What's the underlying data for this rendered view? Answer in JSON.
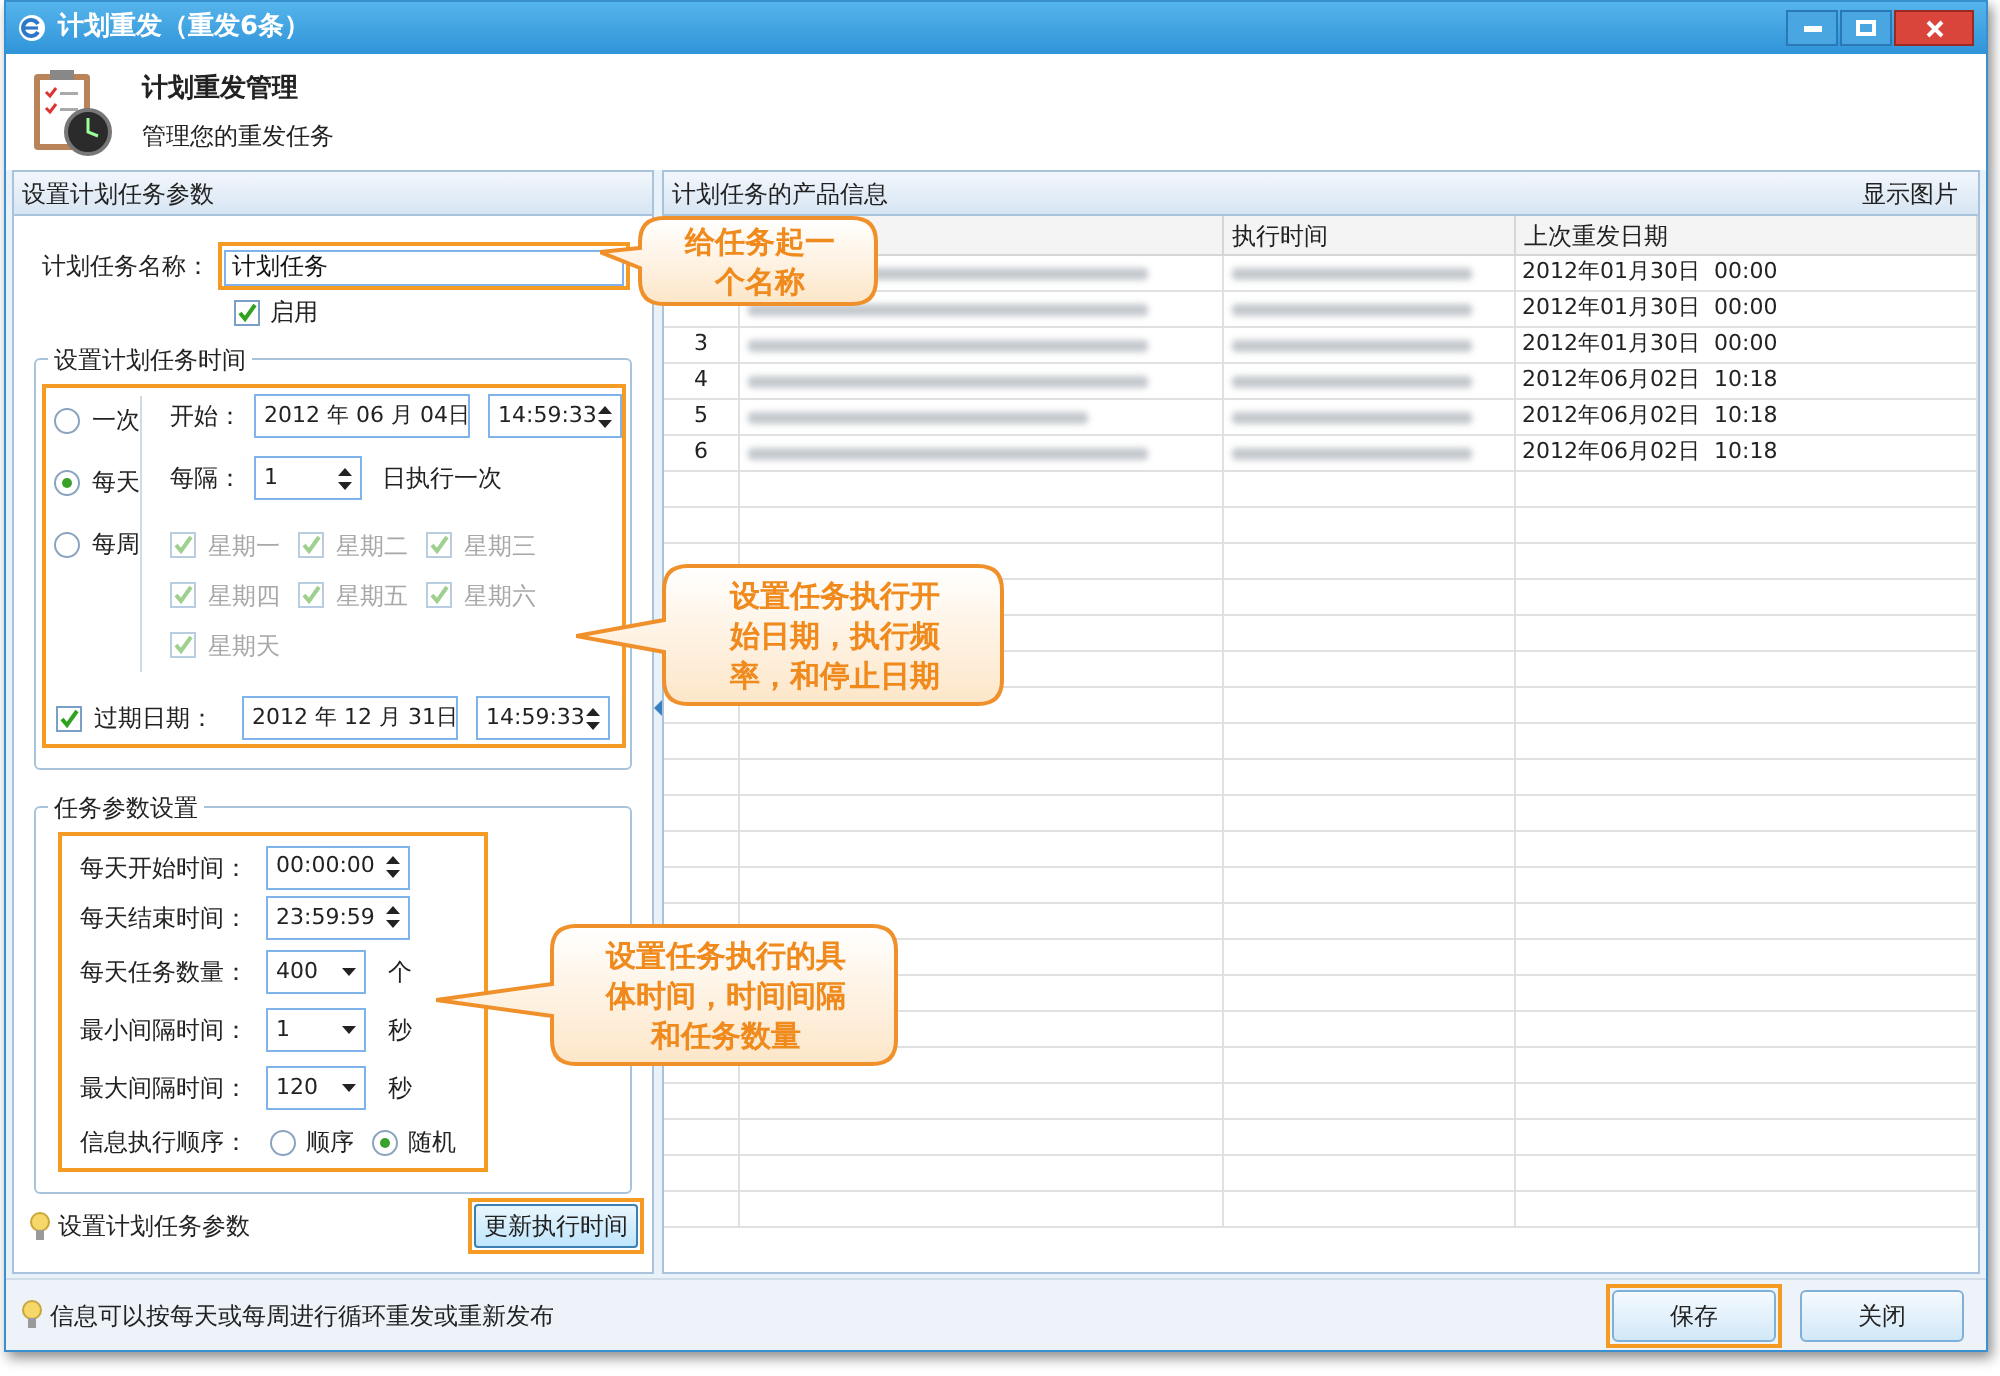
{
  "window": {
    "title": "计划重发（重发6条）"
  },
  "header": {
    "title": "计划重发管理",
    "subtitle": "管理您的重发任务"
  },
  "left_panel": {
    "title": "设置计划任务参数",
    "name_label": "计划任务名称：",
    "name_value": "计划任务",
    "enabled": {
      "label": "启用",
      "checked": true
    },
    "time_group": {
      "title": "设置计划任务时间",
      "modes": [
        {
          "label": "一次",
          "selected": false
        },
        {
          "label": "每天",
          "selected": true
        },
        {
          "label": "每周",
          "selected": false
        }
      ],
      "start_label": "开始：",
      "start_date": "2012 年 06 月 04日",
      "start_time": "14:59:33",
      "interval_label": "每隔：",
      "interval_value": "1",
      "interval_suffix": "日执行一次",
      "weekdays": [
        {
          "label": "星期一",
          "checked": true,
          "disabled": true
        },
        {
          "label": "星期二",
          "checked": true,
          "disabled": true
        },
        {
          "label": "星期三",
          "checked": true,
          "disabled": true
        },
        {
          "label": "星期四",
          "checked": true,
          "disabled": true
        },
        {
          "label": "星期五",
          "checked": true,
          "disabled": true
        },
        {
          "label": "星期六",
          "checked": true,
          "disabled": true
        },
        {
          "label": "星期天",
          "checked": true,
          "disabled": true
        }
      ],
      "expire": {
        "label": "过期日期：",
        "checked": true,
        "date": "2012 年 12 月 31日",
        "time": "14:59:33"
      }
    },
    "param_group": {
      "title": "任务参数设置",
      "rows": [
        {
          "label": "每天开始时间：",
          "kind": "spin",
          "value": "00:00:00"
        },
        {
          "label": "每天结束时间：",
          "kind": "spin",
          "value": "23:59:59"
        },
        {
          "label": "每天任务数量：",
          "kind": "combo",
          "value": "400",
          "unit": "个"
        },
        {
          "label": "最小间隔时间：",
          "kind": "combo",
          "value": "1",
          "unit": "秒"
        },
        {
          "label": "最大间隔时间：",
          "kind": "combo",
          "value": "120",
          "unit": "秒"
        }
      ],
      "order_label": "信息执行顺序：",
      "order_options": [
        {
          "label": "顺序",
          "selected": false
        },
        {
          "label": "随机",
          "selected": true
        }
      ]
    },
    "tip": "设置计划任务参数",
    "update_button": "更新执行时间"
  },
  "right_panel": {
    "title": "计划任务的产品信息",
    "show_images": "显示图片",
    "columns": [
      "执行时间",
      "上次重发日期"
    ],
    "rows": [
      {
        "last": "2012年01月30日  00:00"
      },
      {
        "last": "2012年01月30日  00:00"
      },
      {
        "index": "3",
        "last": "2012年01月30日  00:00"
      },
      {
        "index": "4",
        "last": "2012年06月02日  10:18"
      },
      {
        "index": "5",
        "last": "2012年06月02日  10:18"
      },
      {
        "index": "6",
        "last": "2012年06月02日  10:18"
      }
    ]
  },
  "status_bar": {
    "text": "信息可以按每天或每周进行循环重发或重新发布"
  },
  "buttons": [
    "保存",
    "关闭"
  ],
  "annotations": [
    {
      "text": "给任务起一个名称"
    },
    {
      "text": "设置任务执行开始日期，执行频率，和停止日期"
    },
    {
      "text": "设置任务执行的具体时间，时间间隔和任务数量"
    }
  ]
}
